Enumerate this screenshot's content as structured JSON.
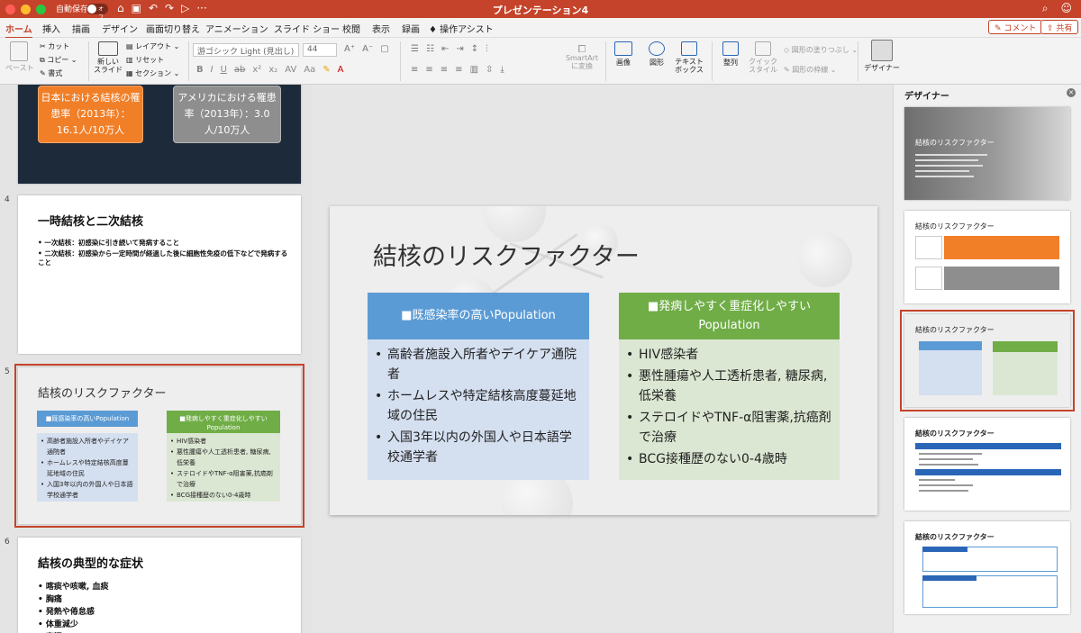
{
  "app": {
    "autosave_label": "自動保存",
    "autosave_state": "オフ",
    "document_title": "プレゼンテーション4"
  },
  "colors": {
    "accent": "#c5432a",
    "blue": "#5b9bd5",
    "green": "#70ad47",
    "orange": "#f07f28",
    "gray": "#8e8e8e"
  },
  "tabs": [
    "ホーム",
    "挿入",
    "描画",
    "デザイン",
    "画面切り替え",
    "アニメーション",
    "スライド ショー",
    "校閲",
    "表示",
    "録画",
    "操作アシスト"
  ],
  "tab_buttons": {
    "comment": "コメント",
    "share": "共有"
  },
  "ribbon": {
    "paste": "ペースト",
    "cut": "カット",
    "copy": "コピー",
    "format": "書式",
    "new_slide": "新しい\nスライド",
    "layout": "レイアウト",
    "reset": "リセット",
    "section": "セクション",
    "font_name": "游ゴシック Light (見出し)",
    "font_size": "44",
    "smartart": "SmartArt\nに変換",
    "picture": "画像",
    "shape": "図形",
    "textbox": "テキスト\nボックス",
    "arrange": "整列",
    "quick_style": "クイック\nスタイル",
    "shape_fill": "図形の塗りつぶし",
    "shape_outline": "図形の枠線",
    "designer": "デザイナー"
  },
  "slides": {
    "s3": {
      "left_pill": "日本における結核の罹患率（2013年）：16.1人/10万人",
      "right_pill": "アメリカにおける罹患率（2013年）：3.0人/10万人"
    },
    "s4": {
      "num": "4",
      "title": "一時結核と二次結核",
      "bullets": [
        "一次結核：初感染に引き続いて発病すること",
        "二次結核：初感染から一定時間が経過した後に細胞性免疫の低下などで発病すること"
      ]
    },
    "s5": {
      "num": "5"
    },
    "s6": {
      "num": "6",
      "title": "結核の典型的な症状",
      "bullets": [
        "喀痰や咳嗽, 血痰",
        "胸痛",
        "発熱や倦怠感",
        "体重減少",
        "寝汗"
      ]
    }
  },
  "main_slide": {
    "title": "結核のリスクファクター",
    "left_header": "■既感染率の高いPopulation",
    "left_items": [
      "高齢者施設入所者やデイケア通院者",
      "ホームレスや特定結核高度蔓延地域の住民",
      "入国3年以内の外国人や日本語学校通学者"
    ],
    "right_header": "■発病しやすく重症化しやすいPopulation",
    "right_items": [
      "HIV感染者",
      "悪性腫瘍や人工透析患者, 糖尿病, 低栄養",
      "ステロイドやTNF-α阻害薬,抗癌剤で治療",
      "BCG接種歴のない0-4歳時"
    ]
  },
  "designer": {
    "title": "デザイナー",
    "card_titles": [
      "結核のリスクファクター",
      "結核のリスクファクター",
      "結核のリスクファクター",
      "結核のリスクファクター",
      "結核のリスクファクター"
    ]
  }
}
